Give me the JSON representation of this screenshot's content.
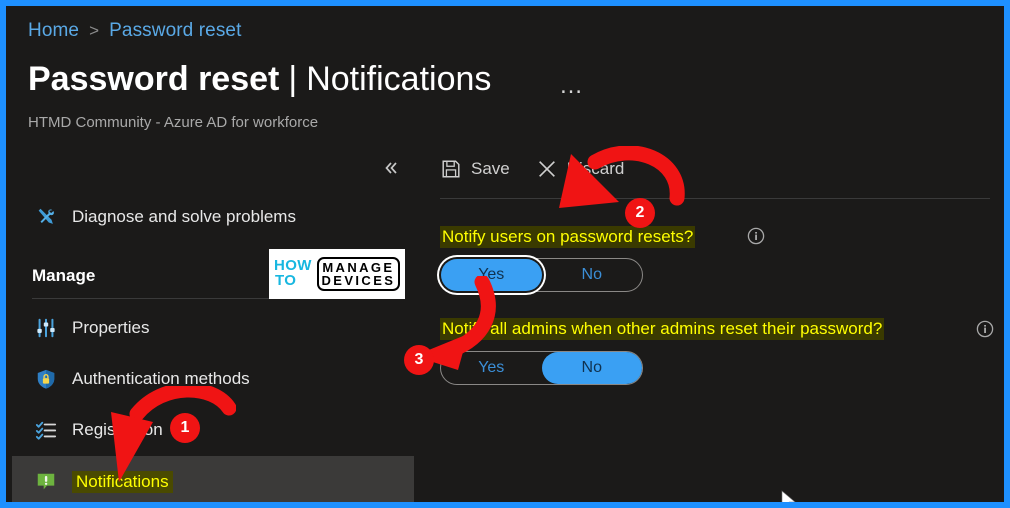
{
  "window": {
    "border_color": "#1e90ff",
    "background": "#1b1a19"
  },
  "breadcrumb": {
    "home": "Home",
    "separator": ">",
    "current": "Password reset"
  },
  "header": {
    "title_primary": "Password reset",
    "title_divider": "|",
    "title_secondary": "Notifications",
    "more_menu": "…",
    "subtitle": "HTMD Community - Azure AD for workforce"
  },
  "sidebar": {
    "collapse_icon": "double-chevron-left-icon",
    "diagnose": {
      "label": "Diagnose and solve problems",
      "icon": "tools-icon"
    },
    "group_label": "Manage",
    "items": [
      {
        "label": "Properties",
        "icon": "sliders-icon",
        "selected": false
      },
      {
        "label": "Authentication methods",
        "icon": "shield-lock-icon",
        "selected": false
      },
      {
        "label": "Registration",
        "icon": "checklist-icon",
        "selected": false
      },
      {
        "label": "Notifications",
        "icon": "notification-bubble-icon",
        "selected": true
      }
    ]
  },
  "toolbar": {
    "save_label": "Save",
    "save_icon": "floppy-disk-icon",
    "discard_label": "Discard",
    "discard_icon": "close-x-icon"
  },
  "settings": [
    {
      "question": "Notify users on password resets?",
      "info_icon": "info-circle-icon",
      "options": [
        "Yes",
        "No"
      ],
      "selected": "Yes",
      "focused": true
    },
    {
      "question": "Notify all admins when other admins reset their password?",
      "info_icon": "info-circle-icon",
      "options": [
        "Yes",
        "No"
      ],
      "selected": "No",
      "focused": false
    }
  ],
  "watermark": {
    "how": "HOW",
    "to": "TO",
    "manage": "MANAGE",
    "devices": "DEVICES",
    "accent_color": "#18b7e0"
  },
  "annotations": {
    "color": "#f01414",
    "badges": [
      {
        "number": "1",
        "target": "sidebar-item-notifications"
      },
      {
        "number": "2",
        "target": "setting-1-toggle"
      },
      {
        "number": "3",
        "target": "setting-2-toggle"
      }
    ]
  },
  "colors": {
    "accent_blue": "#3aa0f3",
    "link_blue": "#5aa9e6",
    "highlight_yellow": "#ffff00",
    "selected_row": "#3b3a39"
  }
}
